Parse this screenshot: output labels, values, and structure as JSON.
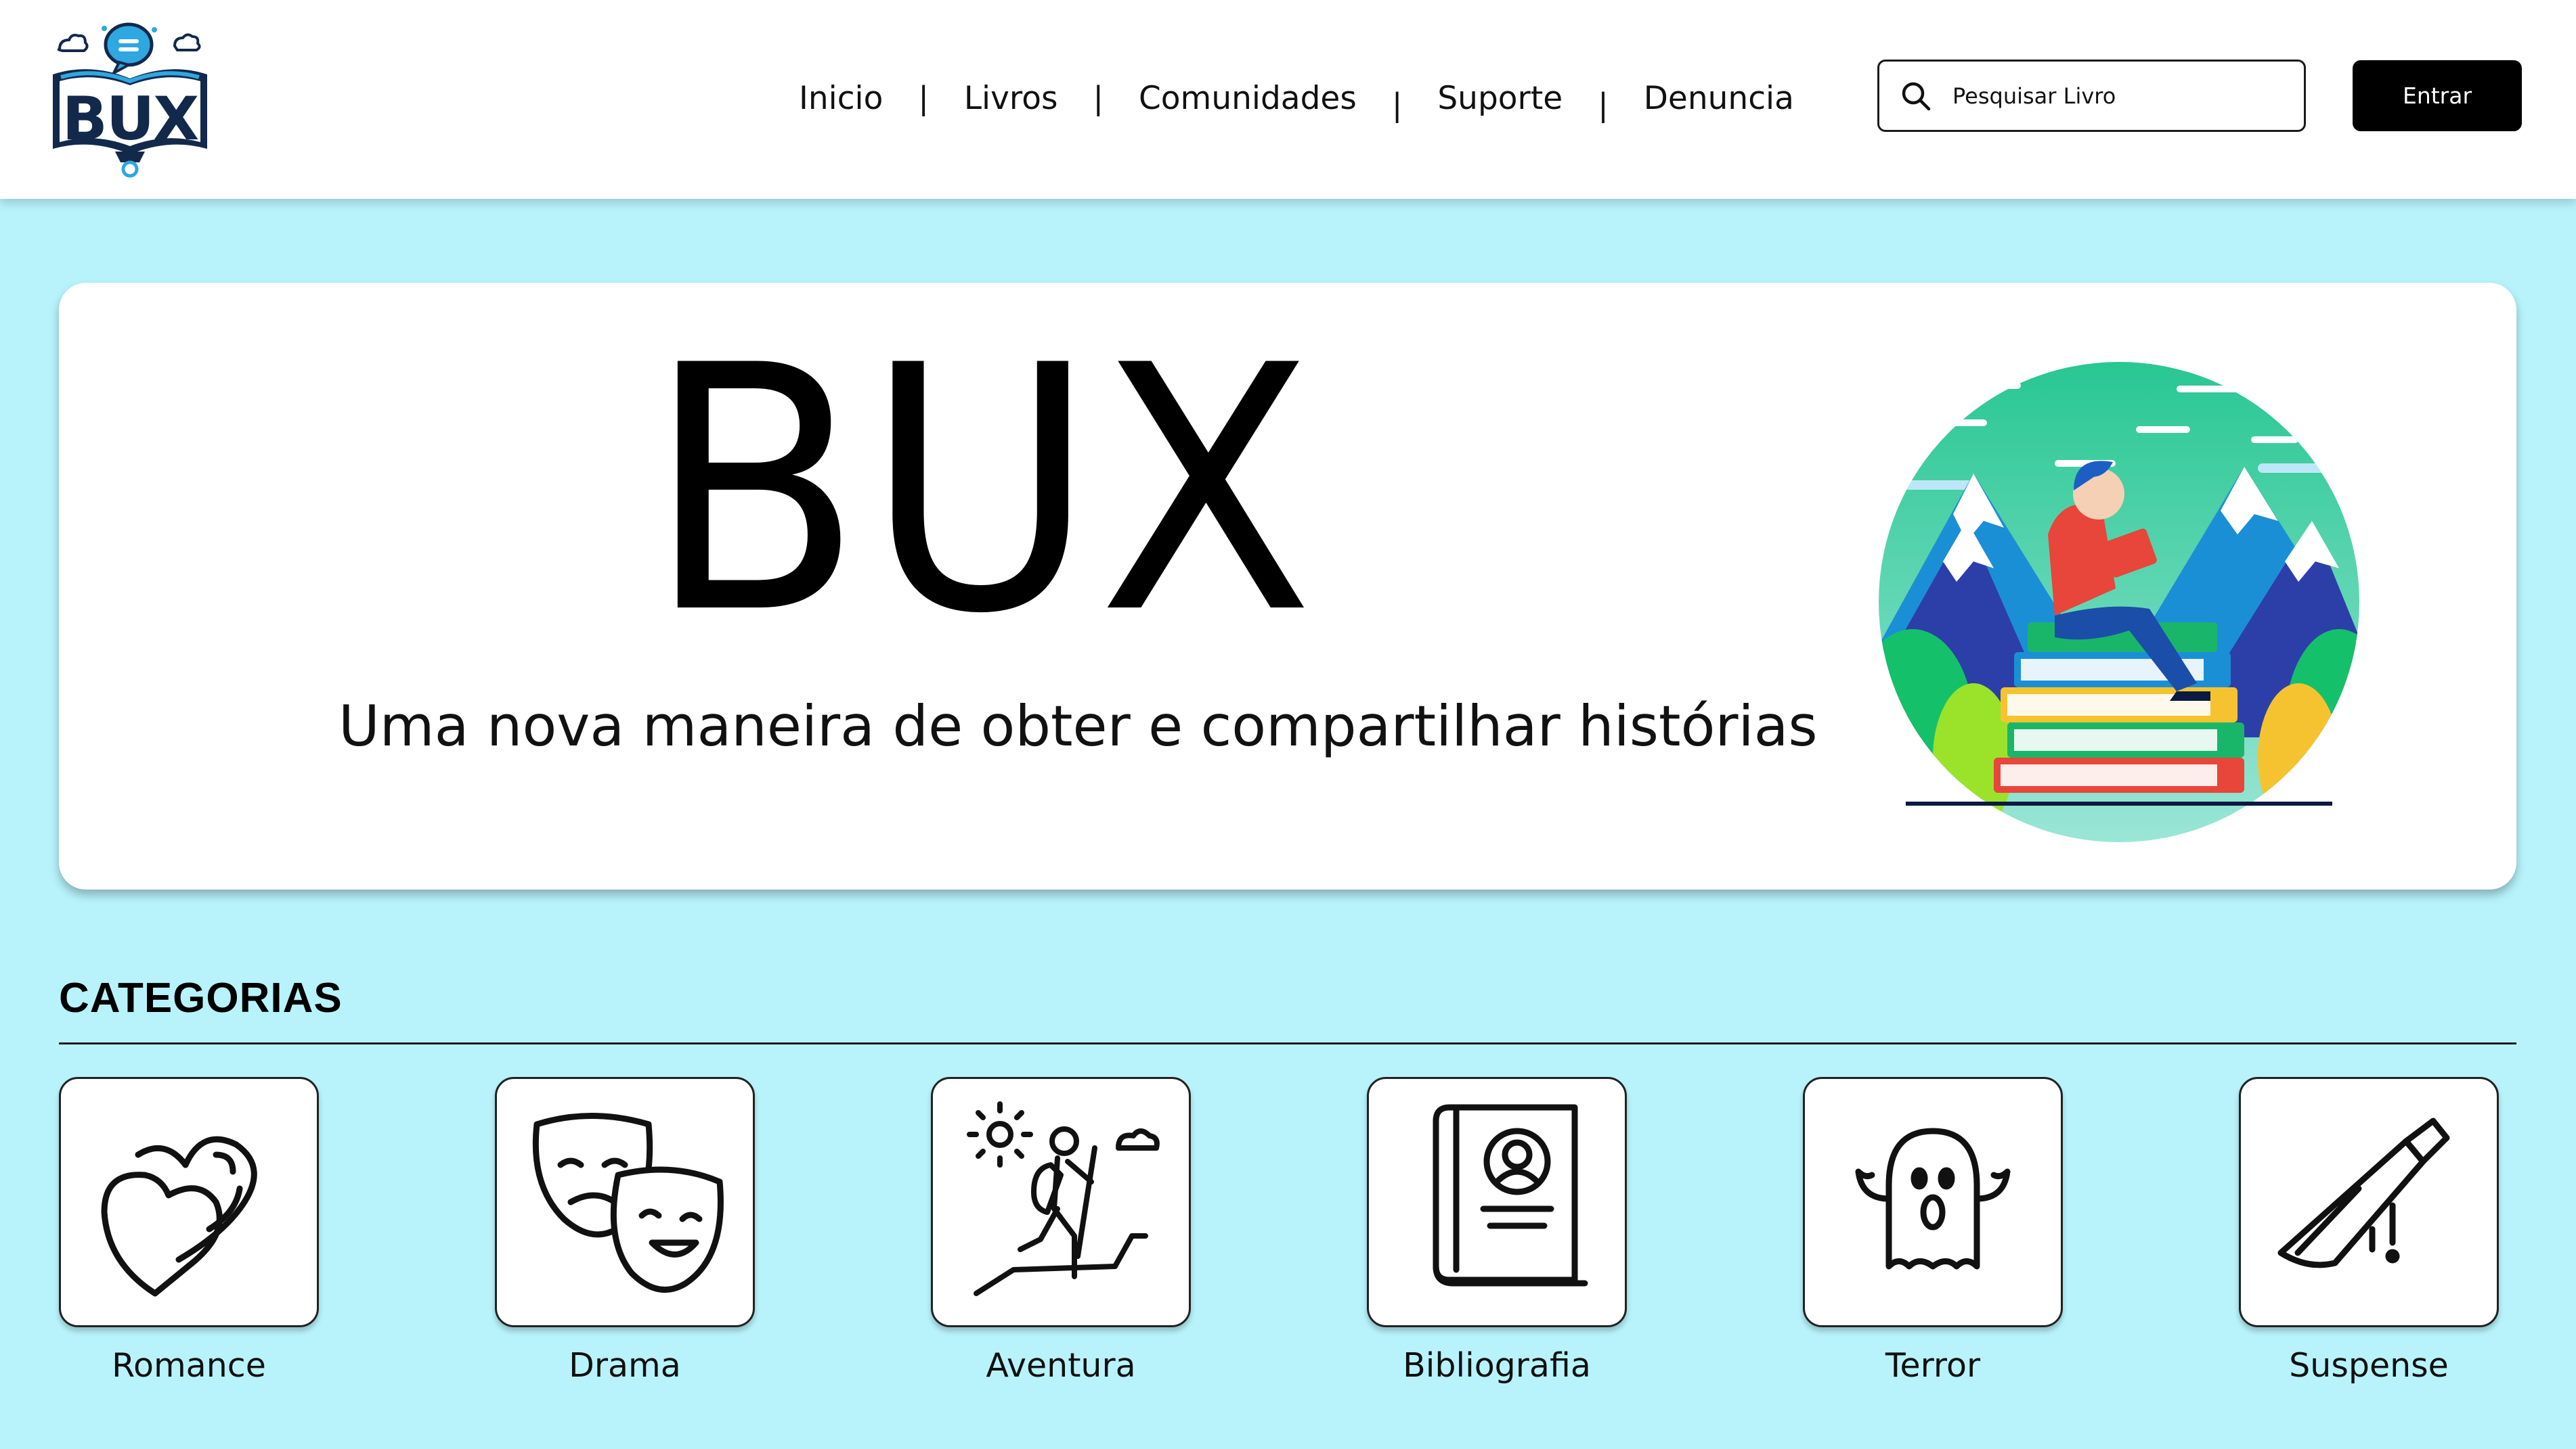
{
  "brand": {
    "logo_text": "BUX"
  },
  "nav": {
    "items": [
      "Inicio",
      "Livros",
      "Comunidades",
      "Suporte",
      "Denuncia"
    ],
    "separator": "|"
  },
  "search": {
    "placeholder": "Pesquisar Livro",
    "icon": "search-icon"
  },
  "login": {
    "label": "Entrar"
  },
  "hero": {
    "title": "BUX",
    "subtitle": "Uma nova maneira de obter e compartilhar histórias",
    "illustration": "person-reading-on-books-illustration"
  },
  "categories": {
    "title": "CATEGORIAS",
    "items": [
      {
        "label": "Romance",
        "icon": "hearts-icon"
      },
      {
        "label": "Drama",
        "icon": "theater-masks-icon"
      },
      {
        "label": "Aventura",
        "icon": "hiker-icon"
      },
      {
        "label": "Bibliografia",
        "icon": "biography-book-icon"
      },
      {
        "label": "Terror",
        "icon": "ghost-icon"
      },
      {
        "label": "Suspense",
        "icon": "bloody-knife-icon"
      }
    ]
  },
  "colors": {
    "page_background": "#b8f3fc",
    "header_background": "#ffffff",
    "button_background": "#000000",
    "logo_navy": "#13294b",
    "logo_blue": "#2fa7e0"
  }
}
